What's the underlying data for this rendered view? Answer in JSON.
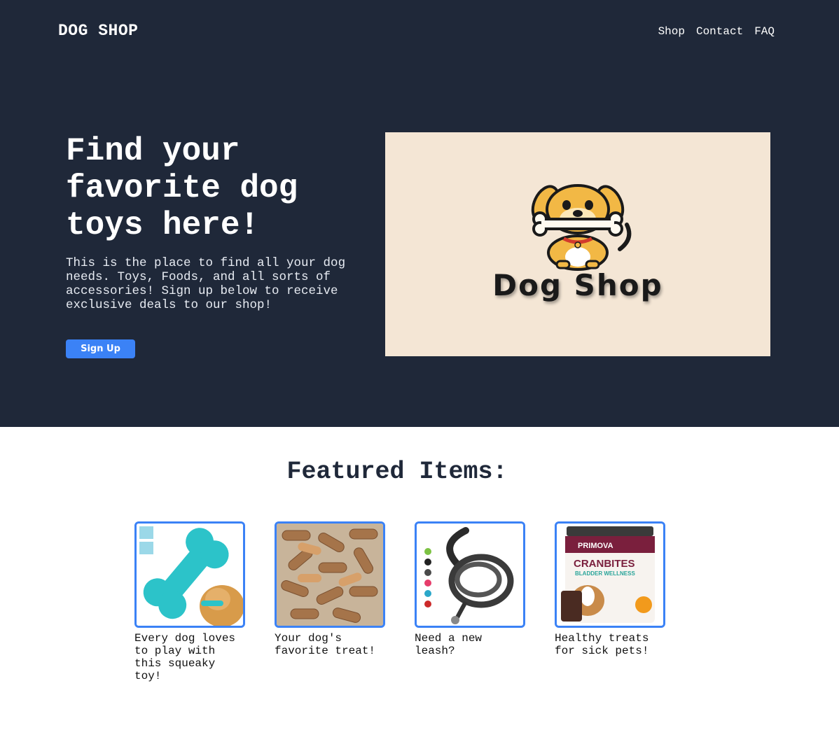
{
  "header": {
    "brand": "DOG SHOP",
    "nav": [
      "Shop",
      "Contact",
      "FAQ"
    ]
  },
  "hero": {
    "title": "Find your favorite dog toys here!",
    "text": "This is the place to find all your dog needs. Toys, Foods, and all sorts of accessories! Sign up below to receive exclusive deals to our shop!",
    "signup_label": "Sign Up",
    "logo_text": "Dog Shop"
  },
  "featured": {
    "title": "Featured Items:",
    "items": [
      {
        "image": "squeaky-bone-toy",
        "desc": "Every dog loves to play with this squeaky toy!"
      },
      {
        "image": "dog-biscuits",
        "desc": "Your dog's favorite treat!"
      },
      {
        "image": "rope-leash",
        "desc": "Need a new leash?"
      },
      {
        "image": "cranbites-treats",
        "desc": "Healthy treats for sick pets!",
        "package_brand": "PRIMOVA",
        "package_title": "CRANBITES",
        "package_subtitle": "BLADDER WELLNESS"
      }
    ]
  },
  "colors": {
    "hero_bg": "#1f2839",
    "accent": "#3b82f6",
    "logo_bg": "#f4e6d5"
  }
}
